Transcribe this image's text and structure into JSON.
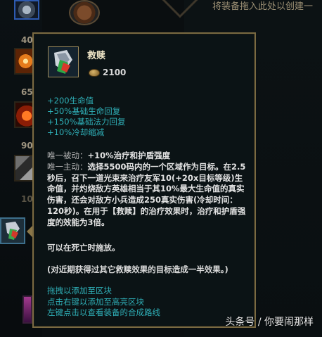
{
  "background": {
    "drop_hint": "将装备拖入此处以创建一",
    "side_prices": [
      "40",
      "65",
      "90",
      "10"
    ]
  },
  "tooltip": {
    "item_name": "救赎",
    "price": "2100",
    "stats": [
      "+200生命值",
      "+50%基础生命回复",
      "+150%基础法力回复",
      "+10%冷却缩减"
    ],
    "passive_label": "唯一被动：",
    "passive_text": "+10%治疗和护盾强度",
    "active_label": "唯一主动：",
    "active_text": "选择5500码内的一个区域作为目标。在2.5秒后，召下一道光束来治疗友军10(+20x目标等级)生命值，并灼烧敌方英雄相当于其10%最大生命值的真实伤害，还会对敌方小兵造成250真实伤害(冷却时间：120秒)。在用于【救赎】的治疗效果时，治疗和护盾强度的效能为3倍。",
    "note1": "可以在死亡时施放。",
    "note2": "(对近期获得过其它救赎效果的目标造成一半效果。)",
    "hints": [
      "拖拽以添加至区块",
      "点击右键以添加至高亮区块",
      "左键点击以查看装备的合成路线"
    ]
  },
  "watermark": "头条号 / 你要闹那样",
  "icons": {
    "item": "redemption-item-icon",
    "gold": "gold-coin-icon"
  },
  "colors": {
    "stat_text": "#2fb0b8",
    "border_gold": "#7a6a42",
    "panel_bg": "#0b1315"
  }
}
